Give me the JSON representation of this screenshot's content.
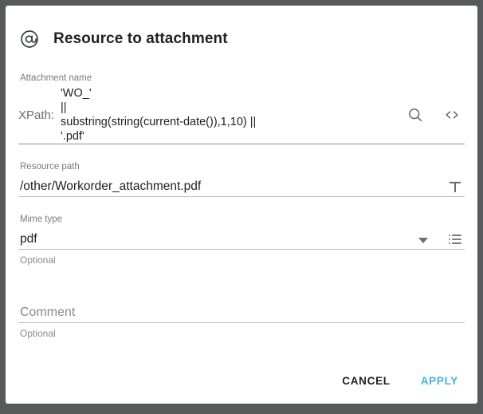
{
  "dialog": {
    "icon": "at-icon",
    "title": "Resource to attachment",
    "fields": {
      "attachment_name": {
        "label": "Attachment name",
        "xpath_label": "XPath:",
        "xpath_value": "'WO_'\n||\nsubstring(string(current-date()),1,10) ||\n'.pdf'",
        "search_icon": "search-icon",
        "code_icon": "code-icon"
      },
      "resource_path": {
        "label": "Resource path",
        "value": "/other/Workorder_attachment.pdf",
        "text_icon": "text-T-icon"
      },
      "mime_type": {
        "label": "Mime type",
        "value": "pdf",
        "helper": "Optional",
        "dropdown_icon": "chevron-down-icon",
        "list_icon": "list-icon"
      },
      "comment": {
        "placeholder": "Comment",
        "value": "",
        "helper": "Optional"
      }
    },
    "footer": {
      "cancel_label": "CANCEL",
      "apply_label": "APPLY"
    }
  },
  "colors": {
    "accent": "#3fb5e8",
    "backdrop": "#58595b",
    "card": "#ffffff",
    "label": "#7a7a7a",
    "text": "#202124"
  }
}
